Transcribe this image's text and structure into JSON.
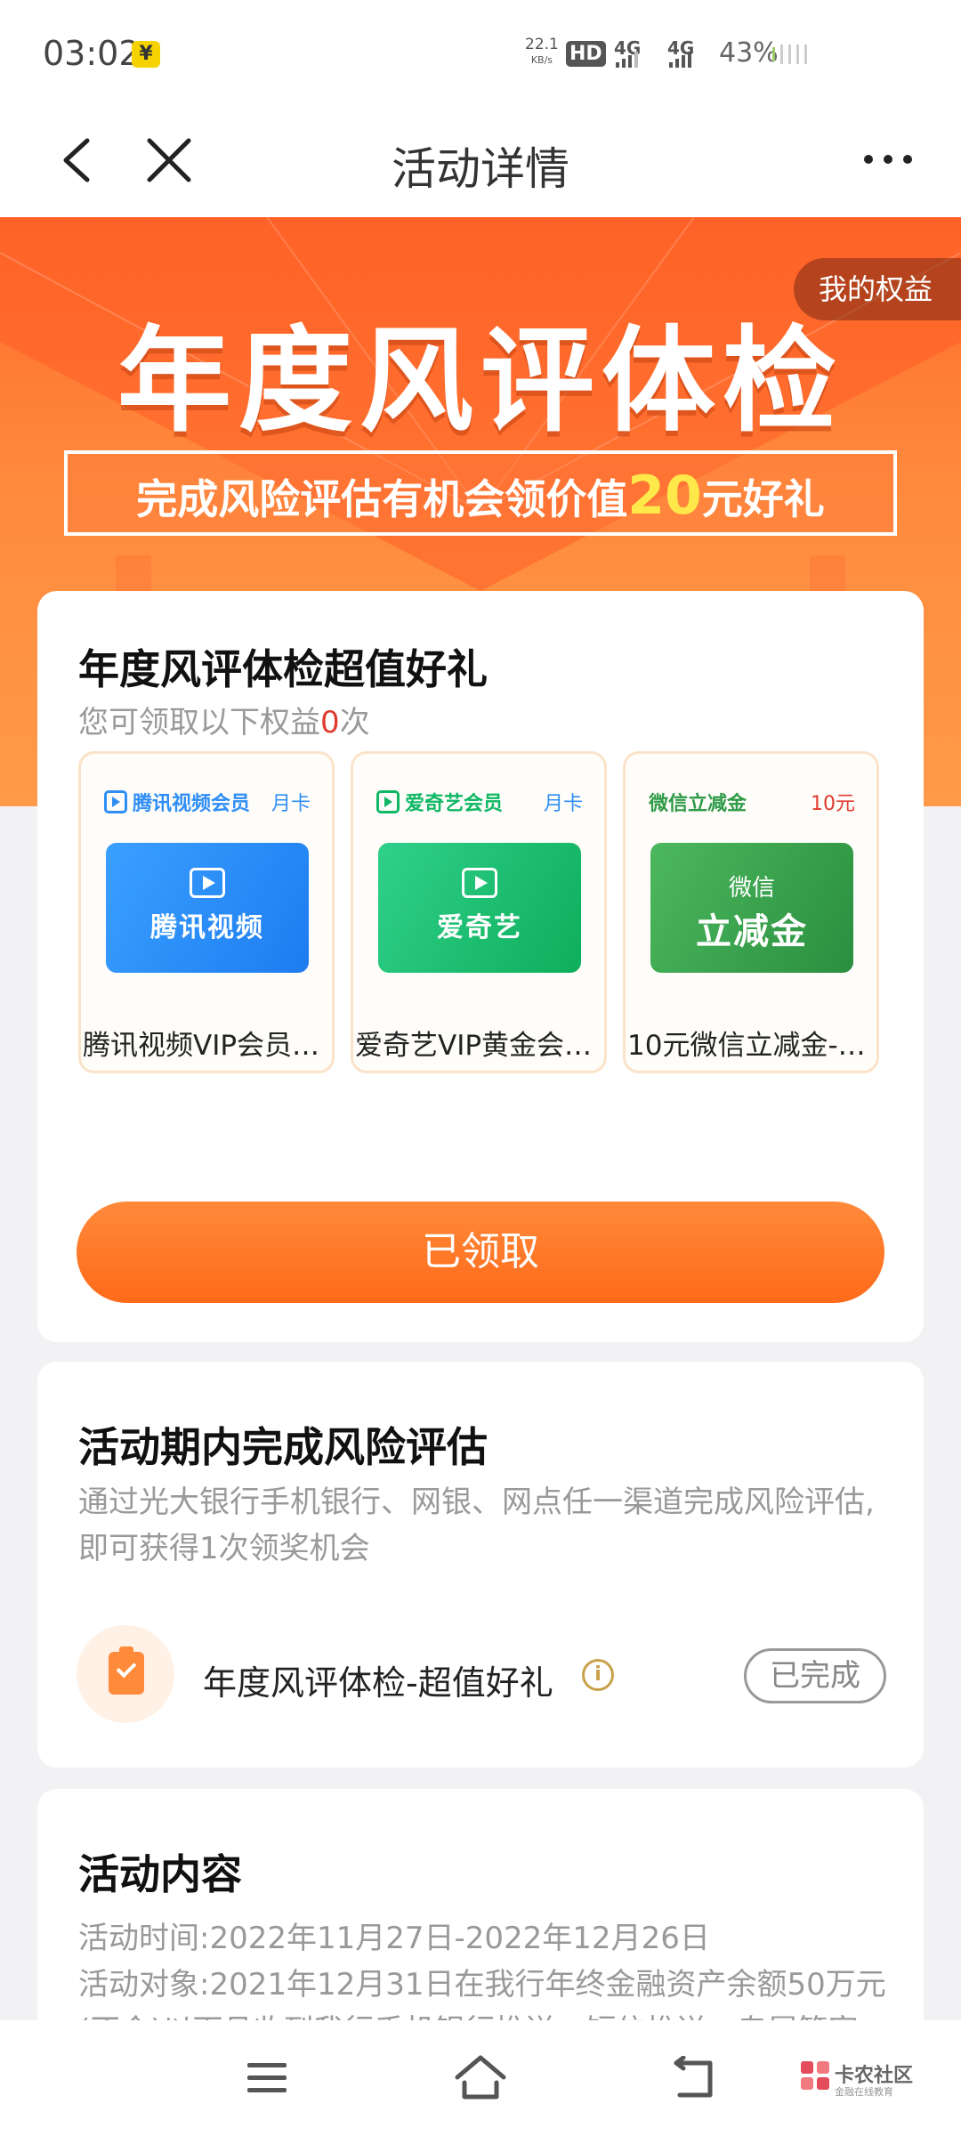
{
  "status_bar": {
    "time": "03:02",
    "yen_badge": "¥",
    "net_speed_value": "22.1",
    "net_speed_unit": "KB/s",
    "hd_label": "HD",
    "net1": "4G",
    "net2": "4G",
    "battery": "43%"
  },
  "nav": {
    "title": "活动详情"
  },
  "banner": {
    "my_rights": "我的权益",
    "title": "年度风评体检",
    "subtitle_pre": "完成风险评估有机会领价值",
    "subtitle_highlight": "20",
    "subtitle_post": "元好礼"
  },
  "gift_card": {
    "title": "年度风评体检超值好礼",
    "sub_pre": "您可领取以下权益",
    "sub_count": "0",
    "sub_post": "次",
    "gifts": [
      {
        "brand": "腾讯视频会员",
        "tag": "月卡",
        "image_text": "腾讯视频",
        "name": "腾讯视频VIP会员…",
        "color": "#2f8ef5"
      },
      {
        "brand": "爱奇艺会员",
        "tag": "月卡",
        "image_text": "爱奇艺",
        "name": "爱奇艺VIP黄金会…",
        "color": "#10b764"
      },
      {
        "brand": "微信立减金",
        "tag": "10元",
        "image_text_top": "微信",
        "image_text": "立减金",
        "name": "10元微信立减金-…",
        "color": "#2f9a47"
      }
    ],
    "button": "已领取"
  },
  "task_card": {
    "title": "活动期内完成风险评估",
    "description": "通过光大银行手机银行、网银、网点任一渠道完成风险评估,即可获得1次领奖机会",
    "task_name": "年度风评体检-超值好礼",
    "info": "i",
    "status": "已完成"
  },
  "content_card": {
    "title": "活动内容",
    "lines": [
      "活动时间:2022年11月27日-2022年12月26日",
      "活动对象:2021年12月31日在我行年终金融资产余额50万元",
      "(不含)以下且收到我行手机银行推送、短信推送、专属管家"
    ]
  },
  "watermark": {
    "name": "卡农社区",
    "slogan": "金融在线教育"
  },
  "colors": {
    "accent": "#ff7a2a",
    "banner_top": "#ff6a2b",
    "count_red": "#e03b2f"
  }
}
